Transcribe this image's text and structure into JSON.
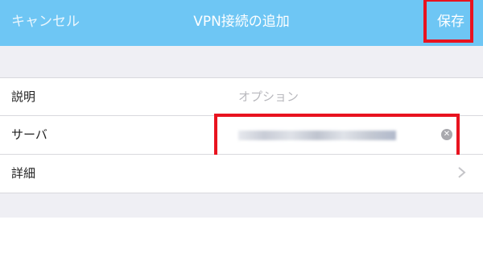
{
  "navbar": {
    "cancel_label": "キャンセル",
    "title": "VPN接続の追加",
    "save_label": "保存"
  },
  "form": {
    "description": {
      "label": "説明",
      "placeholder": "オプション"
    },
    "server": {
      "label": "サーバ",
      "value_blurred": true
    },
    "details": {
      "label": "詳細"
    }
  },
  "colors": {
    "navbar_bg": "#6ec6f4",
    "highlight": "#e8131f",
    "group_bg": "#efeff4"
  },
  "icons": {
    "clear": "clear-icon",
    "chevron": "chevron-right-icon"
  }
}
